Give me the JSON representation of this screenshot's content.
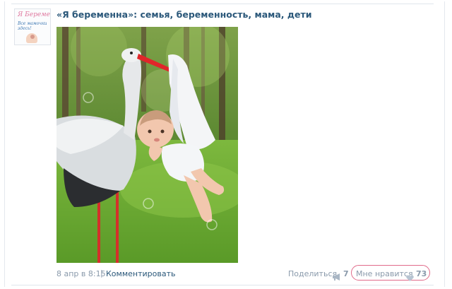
{
  "post": {
    "group_name": "«Я беременна»: семья, беременность, мама, дети",
    "avatar": {
      "logo_text": "Я Беременна",
      "slogan": "Все мамочки здесь!",
      "icon": "group-logo"
    },
    "photo": {
      "icon": "photo-stork-baby"
    },
    "date": "8 апр в 8:15",
    "separator": "|",
    "comment_label": "Комментировать"
  },
  "actions": {
    "share_label": "Поделиться",
    "share_icon": "megaphone-icon",
    "share_count": "7",
    "like_label": "Мне нравится",
    "like_icon": "heart-icon",
    "like_count": "73"
  },
  "colors": {
    "link": "#2b587a",
    "muted": "#8a9aab",
    "highlight_outline": "#e06b8a"
  }
}
